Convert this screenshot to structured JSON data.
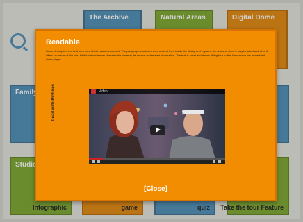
{
  "background_tiles": [
    {
      "id": "top-1",
      "label": "The Archive",
      "color": "blue"
    },
    {
      "id": "top-2",
      "label": "Natural Areas",
      "color": "green"
    },
    {
      "id": "top-3",
      "label": "Digital Dome",
      "color": "orange"
    },
    {
      "id": "mid-left",
      "label": "Family F",
      "color": "blue"
    },
    {
      "id": "bottom-left",
      "label": "Studio",
      "color": "green",
      "footer": "Infographic"
    },
    {
      "id": "bottom-2",
      "label": "",
      "color": "orange",
      "footer": "game"
    },
    {
      "id": "bottom-3",
      "label": "",
      "color": "blue",
      "footer": "quiz"
    },
    {
      "id": "bottom-4",
      "label": "",
      "color": "green",
      "footer": "Take the tour Feature"
    }
  ],
  "modal": {
    "title": "Readable",
    "body": "Some descriptive text is shown here about readable content. The paragraph continues over several lines inside the dialog and explains the resource, how it may be used and what it offers to visitors of the site. Additional sentences describe the material, its source and related information. The text is small and dense, filling four to five lines above the embedded video player.",
    "video_title": "Video",
    "vertical_label": "Lead with Pictures",
    "close_label": "[Close]"
  },
  "colors": {
    "modal": "#f28c00",
    "blue_tile": "#4f8fb8",
    "green_tile": "#7da82f",
    "orange_tile": "#e58a0f"
  },
  "video": {
    "progress": 0.1
  }
}
